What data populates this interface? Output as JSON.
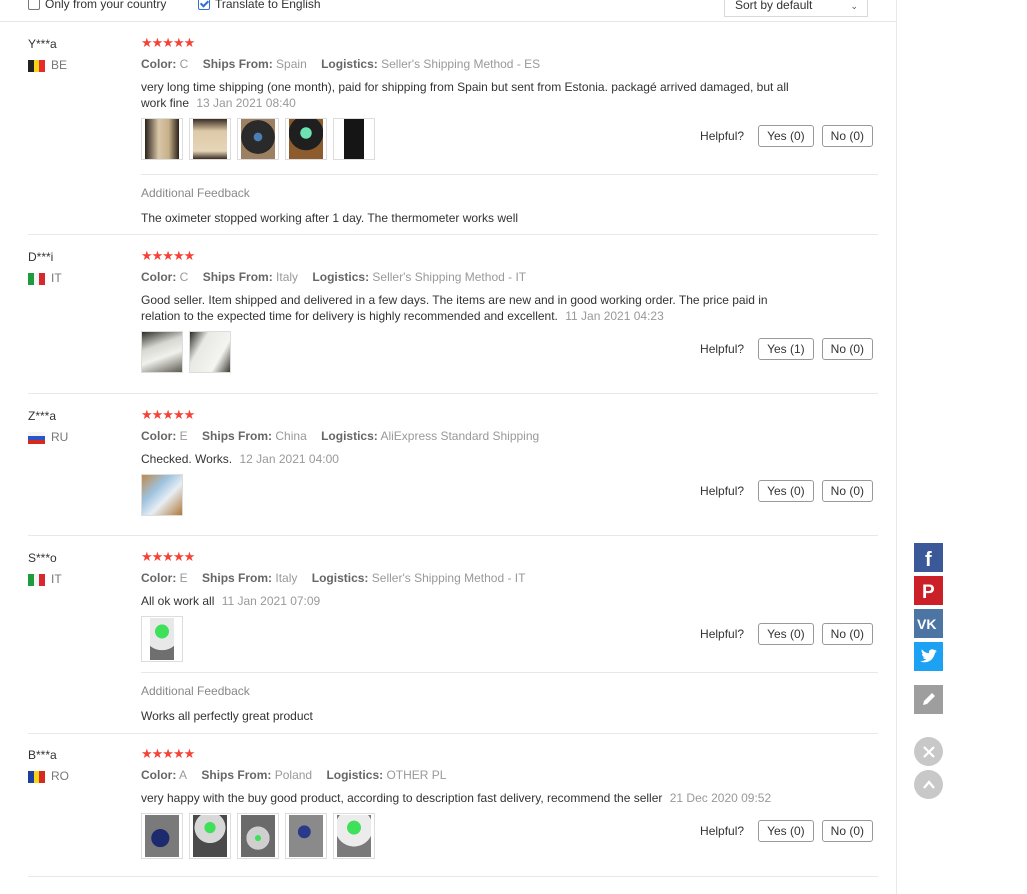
{
  "filters": {
    "only_country_label": "Only from your country",
    "only_country_checked": false,
    "translate_label": "Translate to English",
    "translate_checked": true,
    "sort_value": "Sort by default"
  },
  "labels": {
    "color": "Color:",
    "ships_from": "Ships From:",
    "logistics": "Logistics:",
    "helpful": "Helpful?",
    "additional_feedback": "Additional Feedback"
  },
  "reviews": [
    {
      "user": "Y***a",
      "country": "BE",
      "stars": "★★★★★",
      "color": "C",
      "ships_from": "Spain",
      "logistics": "Seller's Shipping Method - ES",
      "text": "very long time shipping (one month), paid for shipping from Spain but sent from Estonia. packagé arrived damaged, but all work fine",
      "date": "13 Jan 2021 08:40",
      "yes": "Yes (0)",
      "no": "No (0)",
      "additional": "The oximeter stopped working after 1 day. The thermometer works well"
    },
    {
      "user": "D***i",
      "country": "IT",
      "stars": "★★★★★",
      "color": "C",
      "ships_from": "Italy",
      "logistics": "Seller's Shipping Method - IT",
      "text": "Good seller. Item shipped and delivered in a few days. The items are new and in good working order. The price paid in relation to the expected time for delivery is highly recommended and excellent.",
      "date": "11 Jan 2021 04:23",
      "yes": "Yes (1)",
      "no": "No (0)"
    },
    {
      "user": "Z***a",
      "country": "RU",
      "stars": "★★★★★",
      "color": "E",
      "ships_from": "China",
      "logistics": "AliExpress Standard Shipping",
      "text": "Checked. Works.",
      "date": "12 Jan 2021 04:00",
      "yes": "Yes (0)",
      "no": "No (0)"
    },
    {
      "user": "S***o",
      "country": "IT",
      "stars": "★★★★★",
      "color": "E",
      "ships_from": "Italy",
      "logistics": "Seller's Shipping Method - IT",
      "text": "All ok work all",
      "date": "11 Jan 2021 07:09",
      "yes": "Yes (0)",
      "no": "No (0)",
      "additional": "Works all perfectly great product"
    },
    {
      "user": "B***a",
      "country": "RO",
      "stars": "★★★★★",
      "color": "A",
      "ships_from": "Poland",
      "logistics": "OTHER PL",
      "text": "very happy with the buy good product, according to description fast delivery, recommend the seller",
      "date": "21 Dec 2020 09:52",
      "yes": "Yes (0)",
      "no": "No (0)"
    }
  ],
  "social": {
    "facebook_color": "#3b5998",
    "pinterest_color": "#cb2027",
    "vk_color": "#4c75a3",
    "twitter_color": "#1da1f2",
    "edit_color": "#9e9e9e"
  }
}
